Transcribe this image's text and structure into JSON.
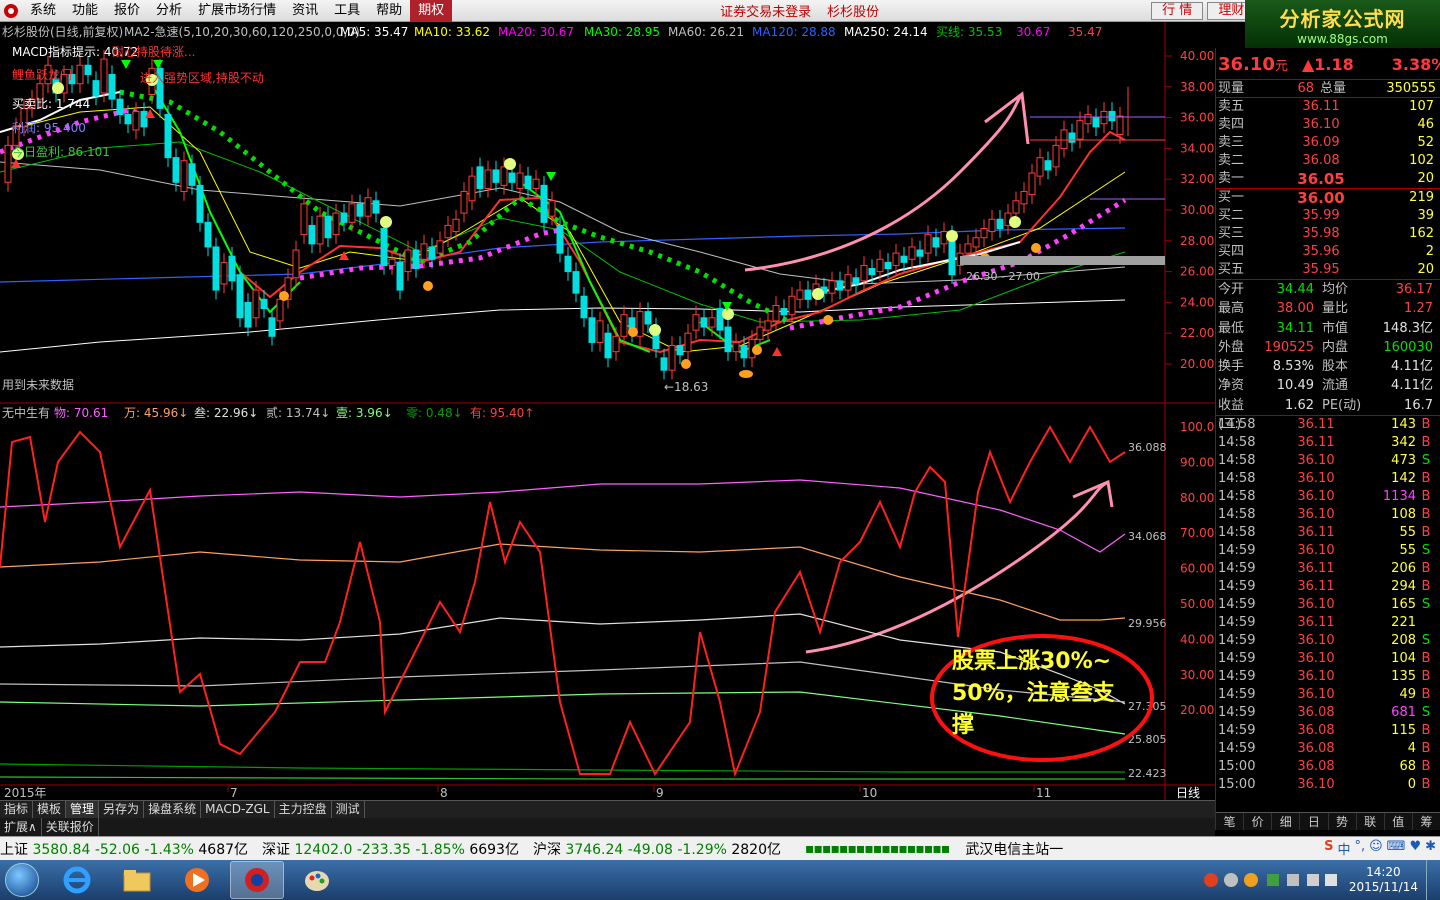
{
  "menu": {
    "items": [
      "系统",
      "功能",
      "报价",
      "分析",
      "扩展市场行情",
      "资讯",
      "工具",
      "帮助"
    ],
    "active_item": "期权",
    "center_texts": [
      "证券交易未登录",
      "杉杉股份"
    ],
    "right_buttons": [
      "行 情",
      "理财"
    ]
  },
  "brand": {
    "name": "分析家公式网",
    "url": "www.88gs.com"
  },
  "chart_header": {
    "title": "杉杉股份(日线,前复权)",
    "ma_label": "MA2-急速(5,10,20,30,60,120,250,0,0,0)",
    "ma_values": [
      {
        "label": "MA5: 35.47",
        "color": "#ffffff"
      },
      {
        "label": "MA10: 33.62",
        "color": "#ffff00"
      },
      {
        "label": "MA20: 30.67",
        "color": "#ff00ff"
      },
      {
        "label": "MA30: 28.95",
        "color": "#00ff00"
      },
      {
        "label": "MA60: 26.21",
        "color": "#c0c0c0"
      },
      {
        "label": "MA120: 28.88",
        "color": "#3060ff"
      },
      {
        "label": "MA250: 24.14",
        "color": "#ffffff"
      },
      {
        "label": "买线: 35.53",
        "color": "#00c000"
      },
      {
        "label": "30.67",
        "color": "#ff00ff"
      },
      {
        "label": "35.47",
        "color": "#ff4040"
      }
    ]
  },
  "overlay_texts": {
    "macd_tip": "MACD指标提示: 40.72",
    "wait_rise": "耐心持股待涨...",
    "gold_label": "鲤鱼跃龙门",
    "tip2": "进入强势区域,持股不动",
    "buy_ratio": "买卖比: 1.744",
    "profit_label": "利润: 95.400",
    "today_profit": "今日盈利: 86.101",
    "future_data": "用到未来数据",
    "low_mark": "←18.63",
    "band_label": "26.30 - 27.00"
  },
  "price_axis": [
    "40.00",
    "38.00",
    "36.00",
    "34.00",
    "32.00",
    "30.00",
    "28.00",
    "26.00",
    "24.00",
    "22.00",
    "20.00"
  ],
  "indicator": {
    "name": "无中生有",
    "values": [
      {
        "label": "物: 70.61",
        "color": "#ff60ff"
      },
      {
        "label": "万: 45.96↓",
        "color": "#ffa060"
      },
      {
        "label": "叁: 22.96↓",
        "color": "#e0e0e0"
      },
      {
        "label": "贰: 13.74↓",
        "color": "#c0c0c0"
      },
      {
        "label": "壹: 3.96↓",
        "color": "#80ff80"
      },
      {
        "label": "零: 0.48↓",
        "color": "#00a000"
      },
      {
        "label": "有: 95.40↑",
        "color": "#ff4040"
      }
    ],
    "axis": [
      "100.0",
      "90.00",
      "80.00",
      "70.00",
      "60.00",
      "50.00",
      "40.00",
      "30.00",
      "20.00"
    ],
    "right_labels": [
      "36.088",
      "34.068",
      "29.956",
      "27.305",
      "25.805",
      "22.423"
    ]
  },
  "annotation": {
    "line1": "股票上涨30%~",
    "line2": "50%，注意叁支",
    "line3": "撑"
  },
  "date_axis": {
    "year": "2015年",
    "months": [
      "7",
      "8",
      "9",
      "10",
      "11"
    ],
    "period": "日线"
  },
  "quote": {
    "price": "36.10",
    "unit": "元",
    "change": "▲1.18",
    "pct": "3.38%",
    "now_vol_label": "现量",
    "now_vol": "68",
    "total_vol_label": "总量",
    "total_vol": "350555",
    "asks": [
      {
        "label": "卖五",
        "price": "36.11",
        "vol": "107"
      },
      {
        "label": "卖四",
        "price": "36.10",
        "vol": "46"
      },
      {
        "label": "卖三",
        "price": "36.09",
        "vol": "52"
      },
      {
        "label": "卖二",
        "price": "36.08",
        "vol": "102"
      },
      {
        "label": "卖一",
        "price": "36.05",
        "vol": "20"
      }
    ],
    "bids": [
      {
        "label": "买一",
        "price": "36.00",
        "vol": "219"
      },
      {
        "label": "买二",
        "price": "35.99",
        "vol": "39"
      },
      {
        "label": "买三",
        "price": "35.98",
        "vol": "162"
      },
      {
        "label": "买四",
        "price": "35.96",
        "vol": "2"
      },
      {
        "label": "买五",
        "price": "35.95",
        "vol": "20"
      }
    ],
    "stats": [
      {
        "k1": "今开",
        "v1": "34.44",
        "c1": "grn",
        "k2": "均价",
        "v2": "36.17",
        "c2": "red"
      },
      {
        "k1": "最高",
        "v1": "38.00",
        "c1": "red",
        "k2": "量比",
        "v2": "1.27",
        "c2": "red"
      },
      {
        "k1": "最低",
        "v1": "34.11",
        "c1": "grn",
        "k2": "市值",
        "v2": "148.3亿",
        "c2": "wht"
      },
      {
        "k1": "外盘",
        "v1": "190525",
        "c1": "red",
        "k2": "内盘",
        "v2": "160030",
        "c2": "grn"
      },
      {
        "k1": "换手",
        "v1": "8.53%",
        "c1": "wht",
        "k2": "股本",
        "v2": "4.11亿",
        "c2": "wht"
      },
      {
        "k1": "净资",
        "v1": "10.49",
        "c1": "wht",
        "k2": "流通",
        "v2": "4.11亿",
        "c2": "wht"
      },
      {
        "k1": "收益(三)",
        "v1": "1.62",
        "c1": "wht",
        "k2": "PE(动)",
        "v2": "16.7",
        "c2": "wht"
      }
    ],
    "ticks": [
      {
        "t": "14:58",
        "p": "36.11",
        "q": "143",
        "bs": "B"
      },
      {
        "t": "14:58",
        "p": "36.11",
        "q": "342",
        "bs": "B"
      },
      {
        "t": "14:58",
        "p": "36.10",
        "q": "473",
        "bs": "S"
      },
      {
        "t": "14:58",
        "p": "36.10",
        "q": "142",
        "bs": "B"
      },
      {
        "t": "14:58",
        "p": "36.10",
        "q": "1134",
        "bs": "B"
      },
      {
        "t": "14:58",
        "p": "36.10",
        "q": "108",
        "bs": "B"
      },
      {
        "t": "14:58",
        "p": "36.11",
        "q": "55",
        "bs": "B"
      },
      {
        "t": "14:59",
        "p": "36.10",
        "q": "55",
        "bs": "S"
      },
      {
        "t": "14:59",
        "p": "36.11",
        "q": "206",
        "bs": "B"
      },
      {
        "t": "14:59",
        "p": "36.11",
        "q": "294",
        "bs": "B"
      },
      {
        "t": "14:59",
        "p": "36.10",
        "q": "165",
        "bs": "S"
      },
      {
        "t": "14:59",
        "p": "36.11",
        "q": "221",
        "bs": ""
      },
      {
        "t": "14:59",
        "p": "36.10",
        "q": "208",
        "bs": "S"
      },
      {
        "t": "14:59",
        "p": "36.10",
        "q": "104",
        "bs": "B"
      },
      {
        "t": "14:59",
        "p": "36.10",
        "q": "135",
        "bs": "B"
      },
      {
        "t": "14:59",
        "p": "36.10",
        "q": "49",
        "bs": "B"
      },
      {
        "t": "14:59",
        "p": "36.08",
        "q": "681",
        "bs": "S"
      },
      {
        "t": "14:59",
        "p": "36.08",
        "q": "115",
        "bs": "B"
      },
      {
        "t": "14:59",
        "p": "36.08",
        "q": "4",
        "bs": "B"
      },
      {
        "t": "15:00",
        "p": "36.08",
        "q": "68",
        "bs": "B"
      },
      {
        "t": "15:00",
        "p": "36.10",
        "q": "0",
        "bs": "B"
      }
    ],
    "tabs": [
      "笔",
      "价",
      "细",
      "日",
      "势",
      "联",
      "值",
      "筹"
    ]
  },
  "bottom_tabs": [
    "指标",
    "模板",
    "管理",
    "另存为",
    "操盘系统",
    "MACD-ZGL",
    "主力控盘",
    "测试"
  ],
  "bottom_tabs_active": "管理",
  "bottom_tabs2": [
    "扩展∧",
    "关联报价"
  ],
  "index_bar": {
    "items": [
      {
        "name": "上证",
        "val": "3580.84",
        "chg": "-52.06",
        "pct": "-1.43%",
        "amt": "4687亿"
      },
      {
        "name": "深证",
        "val": "12402.0",
        "chg": "-233.35",
        "pct": "-1.85%",
        "amt": "6693亿"
      },
      {
        "name": "沪深",
        "val": "3746.24",
        "chg": "-49.08",
        "pct": "-1.29%",
        "amt": "2820亿"
      }
    ],
    "server": "武汉电信主站一",
    "ime": "中"
  },
  "clock": {
    "time": "14:20",
    "date": "2015/11/14"
  },
  "colors": {
    "up": "#ff3a3a",
    "down": "#00e0e0",
    "ma5": "#ffffff",
    "ma10": "#ffff00",
    "ma20": "#ff00ff",
    "ma30": "#00ff00",
    "ma120": "#3060ff",
    "indicator_main": "#ff2020",
    "annotation_ring": "#ff1010"
  }
}
